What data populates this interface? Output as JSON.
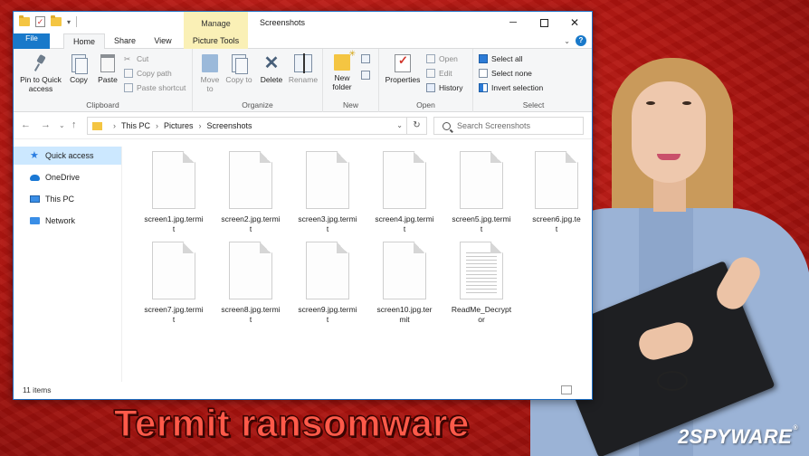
{
  "window": {
    "title": "Screenshots",
    "manage_tab": "Manage",
    "minimize": "─",
    "close": "✕"
  },
  "tabs": {
    "file": "File",
    "home": "Home",
    "share": "Share",
    "view": "View",
    "picture_tools": "Picture Tools"
  },
  "ribbon": {
    "clipboard": {
      "label": "Clipboard",
      "pin": "Pin to Quick access",
      "copy": "Copy",
      "paste": "Paste",
      "cut": "Cut",
      "copy_path": "Copy path",
      "paste_shortcut": "Paste shortcut"
    },
    "organize": {
      "label": "Organize",
      "move_to": "Move to",
      "copy_to": "Copy to",
      "delete": "Delete",
      "rename": "Rename"
    },
    "new": {
      "label": "New",
      "new_folder": "New folder"
    },
    "open": {
      "label": "Open",
      "properties": "Properties",
      "open": "Open",
      "edit": "Edit",
      "history": "History"
    },
    "select": {
      "label": "Select",
      "select_all": "Select all",
      "select_none": "Select none",
      "invert_selection": "Invert selection"
    }
  },
  "address": {
    "crumbs": [
      "This PC",
      "Pictures",
      "Screenshots"
    ],
    "search_placeholder": "Search Screenshots"
  },
  "sidebar": {
    "items": [
      {
        "label": "Quick access",
        "icon": "star-icon"
      },
      {
        "label": "OneDrive",
        "icon": "cloud-icon"
      },
      {
        "label": "This PC",
        "icon": "computer-icon"
      },
      {
        "label": "Network",
        "icon": "network-icon"
      }
    ]
  },
  "files": [
    {
      "line1": "screen1.jpg.termi",
      "line2": "t"
    },
    {
      "line1": "screen2.jpg.termi",
      "line2": "t"
    },
    {
      "line1": "screen3.jpg.termi",
      "line2": "t"
    },
    {
      "line1": "screen4.jpg.termi",
      "line2": "t"
    },
    {
      "line1": "screen5.jpg.termi",
      "line2": "t"
    },
    {
      "line1": "screen6.jpg.te",
      "line2": "t"
    },
    {
      "line1": "screen7.jpg.termi",
      "line2": "t"
    },
    {
      "line1": "screen8.jpg.termi",
      "line2": "t"
    },
    {
      "line1": "screen9.jpg.termi",
      "line2": "t"
    },
    {
      "line1": "screen10.jpg.ter",
      "line2": "mit"
    },
    {
      "line1": "ReadMe_Decrypt",
      "line2": "or"
    }
  ],
  "status": {
    "item_count": "11 items"
  },
  "overlay": {
    "headline": "Termit ransomware",
    "logo": "2SPYWARE",
    "logo_mark": "®"
  },
  "colors": {
    "accent": "#1979ca",
    "manage_tab": "#faf0b6",
    "background_red": "#c41e17",
    "headline": "#ff5a4a"
  }
}
